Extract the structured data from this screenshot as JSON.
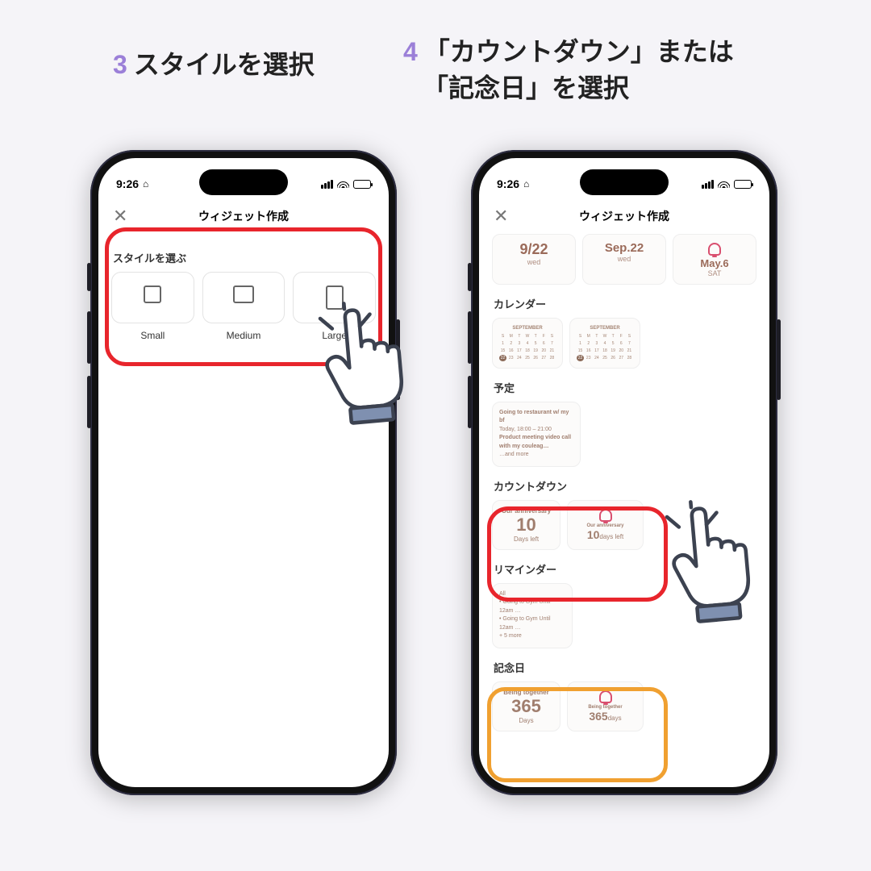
{
  "captions": {
    "step3_num": "3",
    "step3_text": "スタイルを選択",
    "step4_num": "4",
    "step4_line1": "「カウントダウン」または",
    "step4_line2": "「記念日」を選択"
  },
  "status": {
    "time": "9:26",
    "home_indicator": "⌂"
  },
  "navbar": {
    "close": "✕",
    "title": "ウィジェット作成"
  },
  "left": {
    "section_title": "スタイルを選ぶ",
    "styles": [
      "Small",
      "Medium",
      "Large"
    ]
  },
  "right": {
    "dates": {
      "d1_main": "9/22",
      "d1_sub": "wed",
      "d2_main": "Sep.22",
      "d2_sub": "wed",
      "d3_main": "May.6",
      "d3_sub": "SAT"
    },
    "sections": {
      "calendar": "カレンダー",
      "calendar_month": "SEPTEMBER",
      "schedule": "予定",
      "schedule_items": {
        "a_title": "Going to restaurant w/ my bf",
        "a_time": "Today, 18:00 – 21:00",
        "b_title": "Product meeting video call with my couleag…",
        "more": "…and more"
      },
      "countdown": "カウントダウン",
      "countdown_card": {
        "title": "Our anniversary",
        "number": "10",
        "unit": "Days left",
        "alt_number": "10",
        "alt_unit": "days left"
      },
      "reminder": "リマインダー",
      "reminder_items": {
        "all": "All",
        "a": "• Going to Gym Until 12am …",
        "b": "• Going to Gym Until 12am …",
        "more": "+ 5 more"
      },
      "anniversary": "記念日",
      "anniversary_card": {
        "title": "Being together",
        "number": "365",
        "unit": "Days",
        "alt_title": "Being together",
        "alt_number": "365",
        "alt_unit": "days"
      }
    }
  }
}
